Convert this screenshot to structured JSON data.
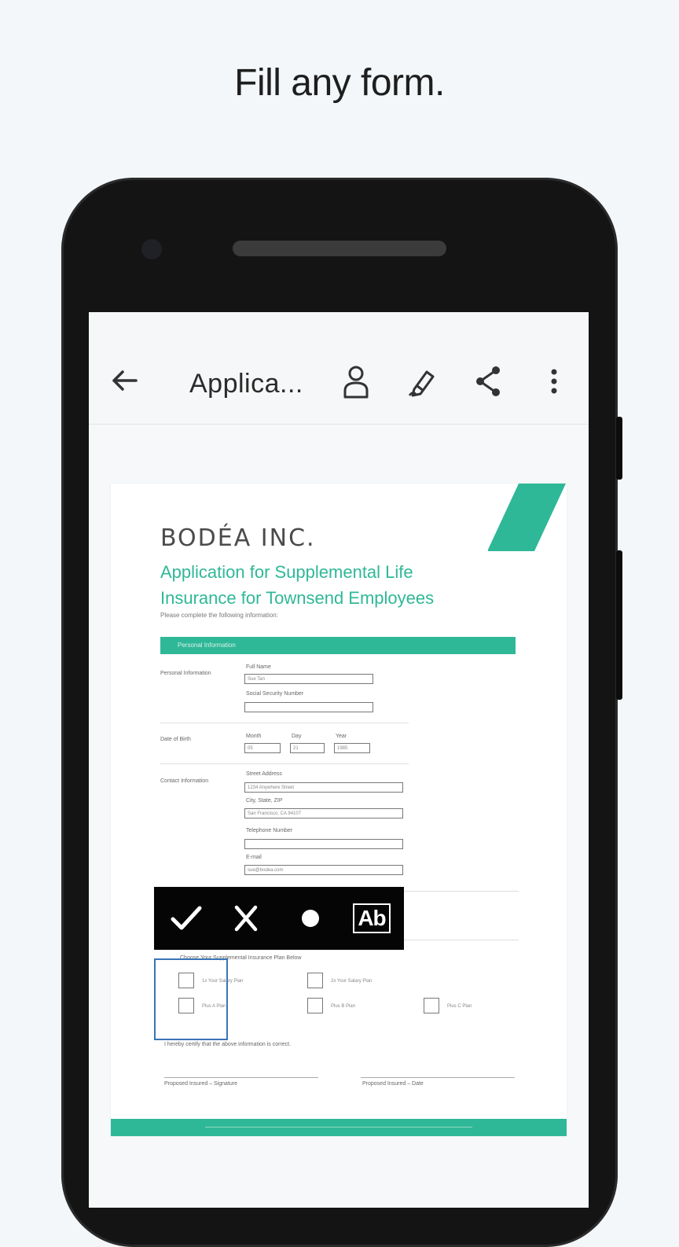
{
  "headline": "Fill any form.",
  "toolbar": {
    "back_icon": "arrow-left-icon",
    "title": "Applica...",
    "icons": [
      "person-icon",
      "pen-sign-icon",
      "share-icon",
      "more-vert-icon"
    ]
  },
  "document": {
    "brand": "BODÉA INC.",
    "title_line1": "Application for Supplemental Life",
    "title_line2": "Insurance for Townsend Employees",
    "subtitle": "Please complete the following information:",
    "section": "Personal Information",
    "personal_label": "Personal Information",
    "full_name_label": "Full Name",
    "full_name_value": "Sue Tan",
    "ssn_label": "Social Security Number",
    "dob_label": "Date of Birth",
    "month_label": "Month",
    "day_label": "Day",
    "year_label": "Year",
    "month_value": "05",
    "day_value": "21",
    "year_value": "1985",
    "contact_label": "Contact Information",
    "street_label": "Street Address",
    "street_value": "1234 Anywhere Street",
    "city_label": "City, State, ZIP",
    "city_value": "San Francisco, CA 94107",
    "phone_label": "Telephone Number",
    "email_label": "E-mail",
    "email_value": "sue@bodea.com",
    "coverage_label": "Choose Your Supplemental Insurance Plan Below",
    "plans": [
      "1x Your Salary Plan",
      "2x Your Salary Plan",
      "Plus A Plan",
      "Plus B Plan",
      "Plus C Plan"
    ],
    "certify": "I hereby certify that the above information is correct.",
    "sig1": "Proposed Insured – Signature",
    "sig2": "Proposed Insured – Date"
  },
  "popup": {
    "buttons": [
      "checkmark-icon",
      "cross-icon",
      "dot-icon",
      "text-field-icon"
    ],
    "ab_label": "Ab"
  },
  "colors": {
    "accent": "#2fb897",
    "selection": "#3a74b5"
  }
}
